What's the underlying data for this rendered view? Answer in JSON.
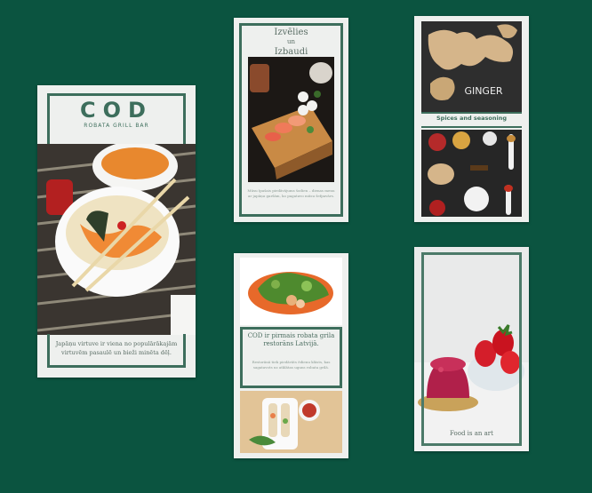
{
  "background_color": "#0b5440",
  "accent_color": "#3d6e5c",
  "cards": [
    {
      "logo": "COD",
      "tagline": "ROBATA GRILL BAR",
      "caption": "Japāņu virtuve ir viena no populārākajām virtuvēm pasaulē un bieži minēta dēļ."
    },
    {
      "title_line1": "Izvēlies",
      "title_line2": "un",
      "title_line3": "Izbaudi",
      "caption": "Mūsu īpašais piedāvājums šodien – dienas menu ar japāņu garšām, ko pagatavo mūsu šefpavārs."
    },
    {
      "photo_label": "GINGER",
      "label": "Spices and seasoning"
    },
    {
      "title": "COD ir pirmais robata grila restorāns Latvijā.",
      "caption": "Restorānā tiek piedāvāts ēdienu klāsts, kas sagatavots uz atklātas uguns robata grilā."
    },
    {
      "caption": "Food is an art"
    }
  ]
}
